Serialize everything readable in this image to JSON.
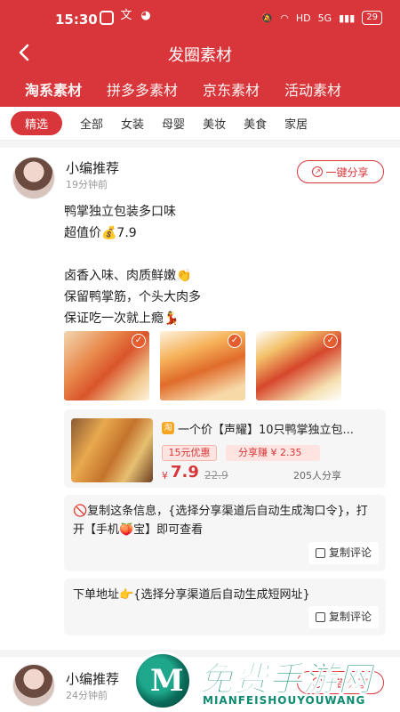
{
  "status_bar": {
    "time": "15:30",
    "battery": "29",
    "signal_labels": [
      "HD",
      "5G"
    ]
  },
  "nav": {
    "back_icon": "back-arrow-icon",
    "title": "发圈素材"
  },
  "tabs": [
    {
      "label": "淘系素材",
      "active": true
    },
    {
      "label": "拼多多素材",
      "active": false
    },
    {
      "label": "京东素材",
      "active": false
    },
    {
      "label": "活动素材",
      "active": false
    }
  ],
  "categories": [
    {
      "label": "精选",
      "selected": true
    },
    {
      "label": "全部"
    },
    {
      "label": "女装"
    },
    {
      "label": "母婴"
    },
    {
      "label": "美妆"
    },
    {
      "label": "美食"
    },
    {
      "label": "家居"
    }
  ],
  "posts": [
    {
      "author": "小编推荐",
      "time": "19分钟前",
      "share_label": "一键分享",
      "content": [
        "鸭掌独立包装多口味",
        "超值价💰7.9",
        "",
        "卤香入味、肉质鲜嫩👏",
        "保留鸭掌筋，个头大肉多",
        "保证吃一次就上瘾💃"
      ],
      "product": {
        "title": "一个价【声耀】10只鸭掌独立包...",
        "coupon": "15元优惠",
        "earn": "分享赚 ¥ 2.35",
        "currency": "¥",
        "price": "7.9",
        "original_price": "22.9",
        "share_count": "205人分享"
      },
      "comments": [
        {
          "text": "🚫复制这条信息，{选择分享渠道后自动生成淘口令}，打开【手机🍑宝】即可查看",
          "copy_label": "复制评论"
        },
        {
          "text": "下单地址👉{选择分享渠道后自动生成短网址}",
          "copy_label": "复制评论"
        }
      ]
    },
    {
      "author": "小编推荐",
      "time": "24分钟前",
      "share_label": "一键分享"
    }
  ],
  "watermark": {
    "title": "免费手游网",
    "subtitle": "MIANFEISHOUYOUWANG"
  },
  "colors": {
    "brand_red": "#d8363a",
    "background": "#f4f4f4"
  }
}
